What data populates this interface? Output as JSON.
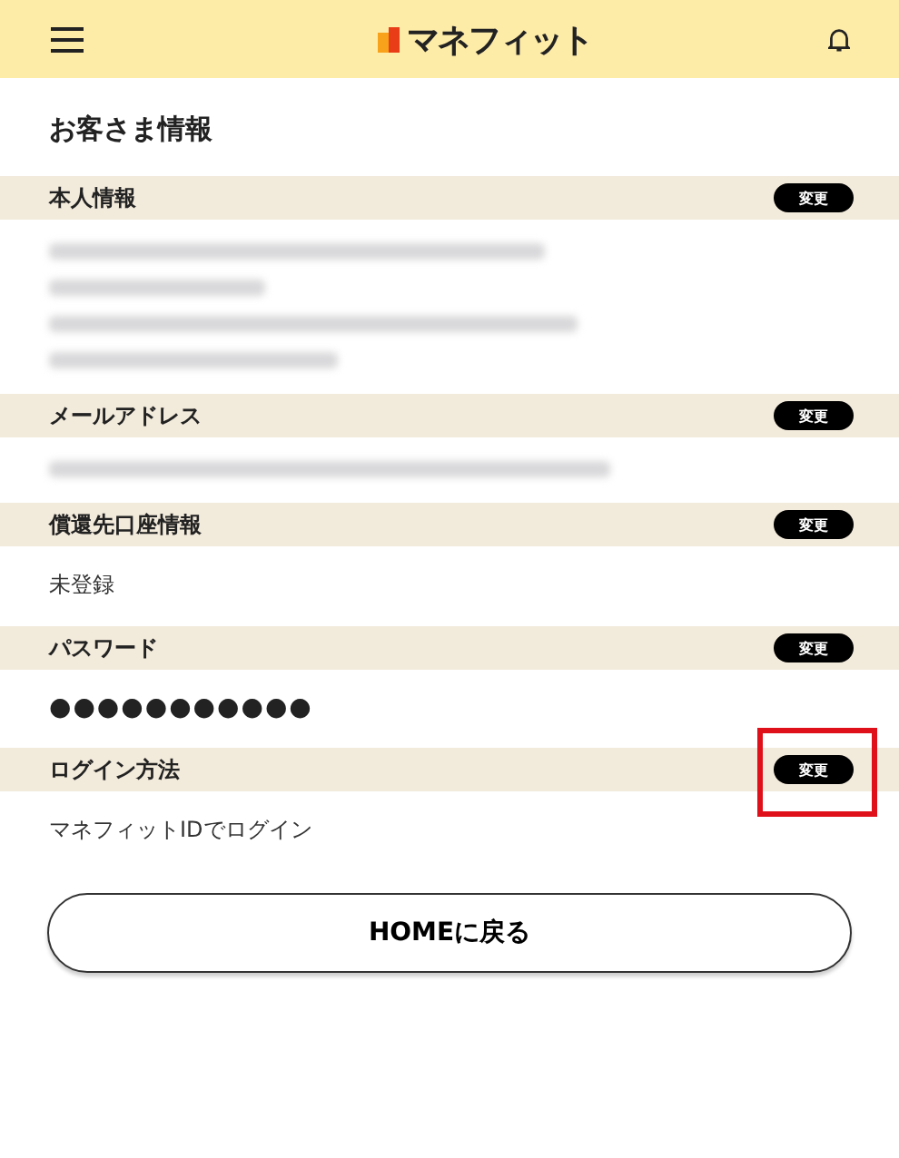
{
  "header": {
    "logo_text": "マネフィット"
  },
  "page_title": "お客さま情報",
  "sections": [
    {
      "title": "本人情報",
      "button": "変更",
      "highlighted": false,
      "lines": [
        {
          "kind": "blurred"
        },
        {
          "kind": "blurred"
        },
        {
          "kind": "blurred"
        },
        {
          "kind": "blurred"
        }
      ]
    },
    {
      "title": "メールアドレス",
      "button": "変更",
      "highlighted": false,
      "lines": [
        {
          "kind": "blurred"
        }
      ]
    },
    {
      "title": "償還先口座情報",
      "button": "変更",
      "highlighted": false,
      "lines": [
        {
          "kind": "text",
          "text": "未登録"
        }
      ]
    },
    {
      "title": "パスワード",
      "button": "変更",
      "highlighted": false,
      "lines": [
        {
          "kind": "secret",
          "text": "●●●●●●●●●●●"
        }
      ]
    },
    {
      "title": "ログイン方法",
      "button": "変更",
      "highlighted": true,
      "lines": [
        {
          "kind": "text",
          "text": "マネフィットIDでログイン"
        }
      ]
    }
  ],
  "home_button": "HOMEに戻る"
}
